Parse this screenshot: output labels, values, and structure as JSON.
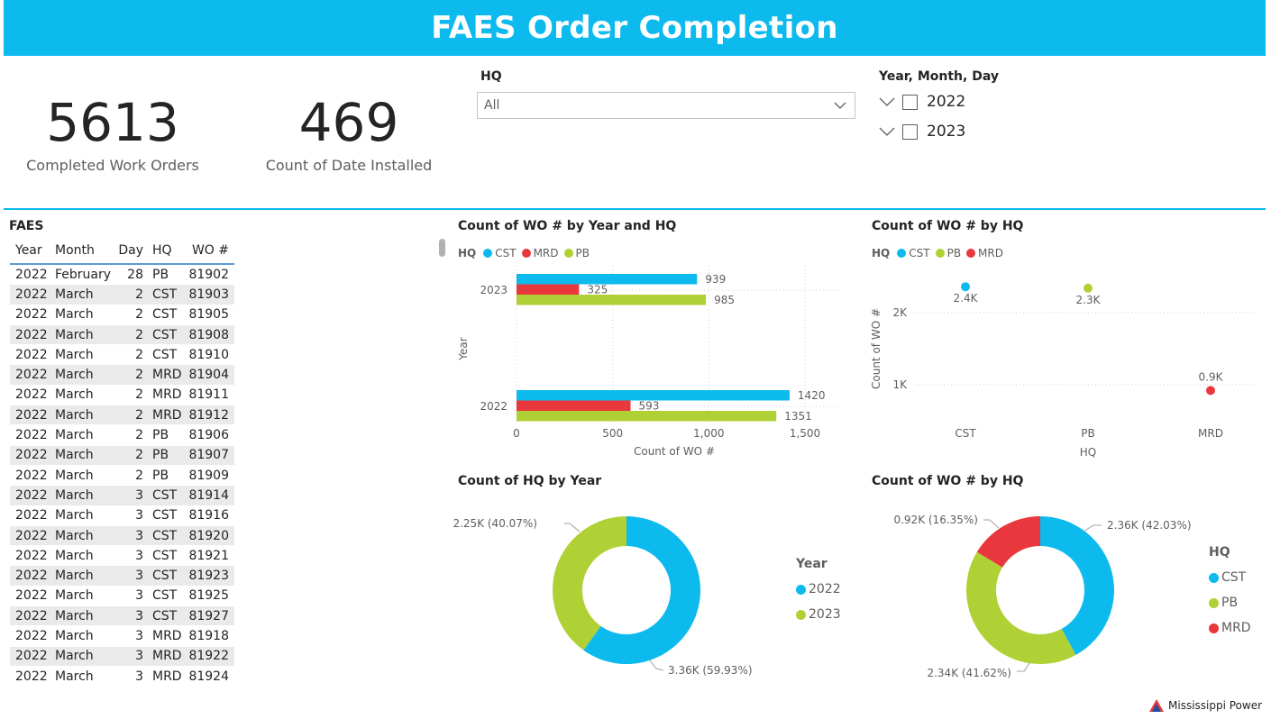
{
  "header": {
    "title": "FAES Order Completion"
  },
  "cards": [
    {
      "value": "5613",
      "label": "Completed Work Orders"
    },
    {
      "value": "469",
      "label": "Count of Date Installed"
    }
  ],
  "hq_slicer": {
    "title": "HQ",
    "selected": "All"
  },
  "date_slicer": {
    "title": "Year, Month, Day",
    "items": [
      "2022",
      "2023"
    ]
  },
  "table": {
    "title": "FAES",
    "columns": [
      "Year",
      "Month",
      "Day",
      "HQ",
      "WO #"
    ],
    "rows": [
      [
        "2022",
        "February",
        "28",
        "PB",
        "81902"
      ],
      [
        "2022",
        "March",
        "2",
        "CST",
        "81903"
      ],
      [
        "2022",
        "March",
        "2",
        "CST",
        "81905"
      ],
      [
        "2022",
        "March",
        "2",
        "CST",
        "81908"
      ],
      [
        "2022",
        "March",
        "2",
        "CST",
        "81910"
      ],
      [
        "2022",
        "March",
        "2",
        "MRD",
        "81904"
      ],
      [
        "2022",
        "March",
        "2",
        "MRD",
        "81911"
      ],
      [
        "2022",
        "March",
        "2",
        "MRD",
        "81912"
      ],
      [
        "2022",
        "March",
        "2",
        "PB",
        "81906"
      ],
      [
        "2022",
        "March",
        "2",
        "PB",
        "81907"
      ],
      [
        "2022",
        "March",
        "2",
        "PB",
        "81909"
      ],
      [
        "2022",
        "March",
        "3",
        "CST",
        "81914"
      ],
      [
        "2022",
        "March",
        "3",
        "CST",
        "81916"
      ],
      [
        "2022",
        "March",
        "3",
        "CST",
        "81920"
      ],
      [
        "2022",
        "March",
        "3",
        "CST",
        "81921"
      ],
      [
        "2022",
        "March",
        "3",
        "CST",
        "81923"
      ],
      [
        "2022",
        "March",
        "3",
        "CST",
        "81925"
      ],
      [
        "2022",
        "March",
        "3",
        "CST",
        "81927"
      ],
      [
        "2022",
        "March",
        "3",
        "MRD",
        "81918"
      ],
      [
        "2022",
        "March",
        "3",
        "MRD",
        "81922"
      ],
      [
        "2022",
        "March",
        "3",
        "MRD",
        "81924"
      ]
    ]
  },
  "colors": {
    "CST": "#0dbaee",
    "MRD": "#e8383d",
    "PB": "#b0d135",
    "accent": "#0dbaee"
  },
  "chart_data": [
    {
      "type": "bar",
      "orientation": "horizontal",
      "title": "Count of WO # by Year and HQ",
      "legend_title": "HQ",
      "categories": [
        "2023",
        "2022"
      ],
      "series": [
        {
          "name": "CST",
          "values": [
            939,
            1420
          ]
        },
        {
          "name": "MRD",
          "values": [
            325,
            593
          ]
        },
        {
          "name": "PB",
          "values": [
            985,
            1351
          ]
        }
      ],
      "xlabel": "Count of WO #",
      "ylabel": "Year",
      "xlim": [
        0,
        1650
      ],
      "xticks": [
        "0",
        "500",
        "1,000",
        "1,500"
      ],
      "grid": true,
      "legend": "top-left"
    },
    {
      "type": "scatter",
      "title": "Count of WO # by HQ",
      "legend_title": "HQ",
      "categories": [
        "CST",
        "PB",
        "MRD"
      ],
      "values": [
        2360,
        2340,
        920
      ],
      "data_labels": [
        "2.4K",
        "2.3K",
        "0.9K"
      ],
      "xlabel": "HQ",
      "ylabel": "Count of WO #",
      "yticks": [
        "1K",
        "2K"
      ],
      "grid": true,
      "legend": "top-left"
    },
    {
      "type": "pie",
      "donut": true,
      "title": "Count of HQ by Year",
      "legend_title": "Year",
      "slices": [
        {
          "name": "2022",
          "value": 3360,
          "label": "3.36K (59.93%)"
        },
        {
          "name": "2023",
          "value": 2250,
          "label": "2.25K (40.07%)"
        }
      ],
      "legend": "right"
    },
    {
      "type": "pie",
      "donut": true,
      "title": "Count of WO # by HQ",
      "legend_title": "HQ",
      "slices": [
        {
          "name": "CST",
          "value": 2360,
          "label": "2.36K (42.03%)"
        },
        {
          "name": "PB",
          "value": 2340,
          "label": "2.34K (41.62%)"
        },
        {
          "name": "MRD",
          "value": 920,
          "label": "0.92K (16.35%)"
        }
      ],
      "legend": "right"
    }
  ],
  "brand": {
    "name": "Mississippi Power"
  }
}
